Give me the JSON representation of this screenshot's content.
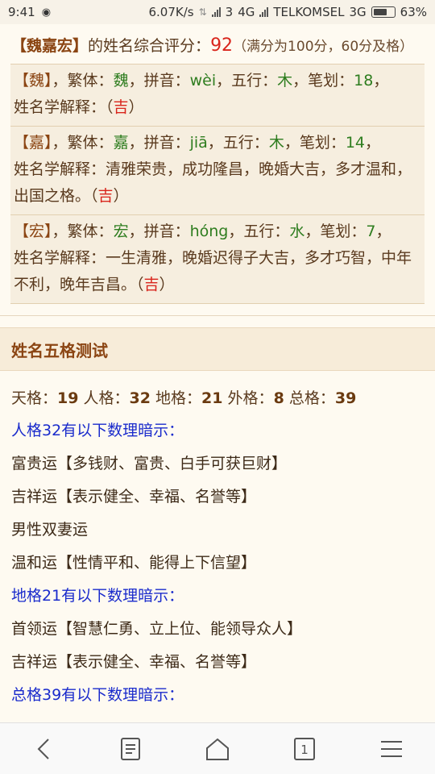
{
  "status": {
    "time": "9:41",
    "speed": "6.07K/s",
    "sim": "3",
    "network": "4G",
    "carrier": "TELKOMSEL",
    "network2": "3G",
    "battery": "63%"
  },
  "summary": {
    "bracket_open": "【",
    "name": "魏嘉宏",
    "bracket_close": "】",
    "text": "的姓名综合评分：",
    "score": "92",
    "note": "（满分为100分，60分及格）"
  },
  "chars": [
    {
      "char": "魏",
      "trad_label": "，繁体：",
      "trad": "魏",
      "pinyin_label": "，拼音：",
      "pinyin": "wèi",
      "wuxing_label": "，五行：",
      "wuxing": "木",
      "strokes_label": "，笔划：",
      "strokes": "18",
      "tail": "，",
      "explain_label": "姓名学解释：",
      "explain": "",
      "luck": "吉"
    },
    {
      "char": "嘉",
      "trad_label": "，繁体：",
      "trad": "嘉",
      "pinyin_label": "，拼音：",
      "pinyin": "jiā",
      "wuxing_label": "，五行：",
      "wuxing": "木",
      "strokes_label": "，笔划：",
      "strokes": "14",
      "tail": "，",
      "explain_label": "姓名学解释：",
      "explain": "清雅荣贵，成功隆昌，晚婚大吉，多才温和，出国之格。",
      "luck": "吉"
    },
    {
      "char": "宏",
      "trad_label": "，繁体：",
      "trad": "宏",
      "pinyin_label": "，拼音：",
      "pinyin": "hóng",
      "wuxing_label": "，五行：",
      "wuxing": "水",
      "strokes_label": "，笔划：",
      "strokes": "7",
      "tail": "，",
      "explain_label": "姓名学解释：",
      "explain": "一生清雅，晚婚迟得子大吉，多才巧智，中年不利，晚年吉昌。",
      "luck": "吉"
    }
  ],
  "section": {
    "title": "姓名五格测试",
    "grids": [
      {
        "label": "天格：",
        "value": "19"
      },
      {
        "label": "人格：",
        "value": "32"
      },
      {
        "label": "地格：",
        "value": "21"
      },
      {
        "label": "外格：",
        "value": "8"
      },
      {
        "label": "总格：",
        "value": "39"
      }
    ],
    "lines": [
      {
        "text": "人格32有以下数理暗示：",
        "blue": true
      },
      {
        "text": "富贵运【多钱财、富贵、白手可获巨财】",
        "blue": false
      },
      {
        "text": "吉祥运【表示健全、幸福、名誉等】",
        "blue": false
      },
      {
        "text": "男性双妻运",
        "blue": false
      },
      {
        "text": "温和运【性情平和、能得上下信望】",
        "blue": false
      },
      {
        "text": "地格21有以下数理暗示：",
        "blue": true
      },
      {
        "text": "首领运【智慧仁勇、立上位、能领导众人】",
        "blue": false
      },
      {
        "text": "吉祥运【表示健全、幸福、名誉等】",
        "blue": false
      },
      {
        "text": "总格39有以下数理暗示：",
        "blue": true
      }
    ]
  },
  "nav": {
    "tab_count": "1"
  }
}
